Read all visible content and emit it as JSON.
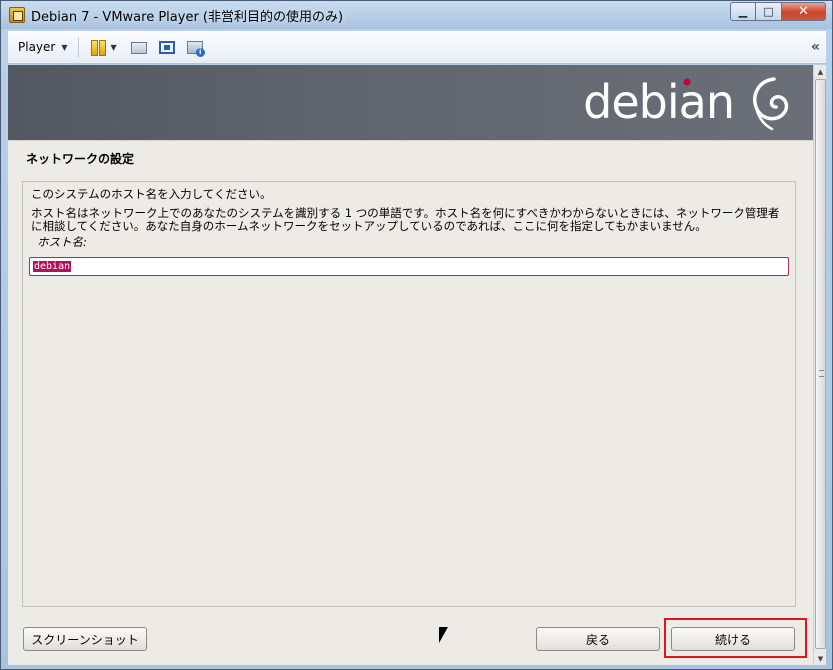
{
  "window": {
    "title": "Debian 7 - VMware Player (非営利目的の使用のみ)",
    "controls": {
      "minimize": "▁",
      "maximize": "□",
      "close": "✕"
    }
  },
  "toolbar": {
    "player_label": "Player",
    "icons": [
      "pause-icon",
      "network-icon",
      "fullscreen-icon",
      "unity-icon",
      "collapse-icon"
    ]
  },
  "installer": {
    "logo_text": "debian",
    "section_title": "ネットワークの設定",
    "prompt": "このシステムのホスト名を入力してください。",
    "help": "ホスト名はネットワーク上でのあなたのシステムを識別する 1 つの単語です。ホスト名を何にすべきかわからないときには、ネットワーク管理者に相談してください。あなた自身のホームネットワークをセットアップしているのであれば、ここに何を指定してもかまいません。",
    "field_label": "ホスト名:",
    "hostname_value": "debian",
    "buttons": {
      "screenshot": "スクリーンショット",
      "back": "戻る",
      "continue": "続ける"
    }
  },
  "colors": {
    "accent": "#b0125a",
    "highlight": "#e2141b",
    "banner": "#5b5f68"
  }
}
